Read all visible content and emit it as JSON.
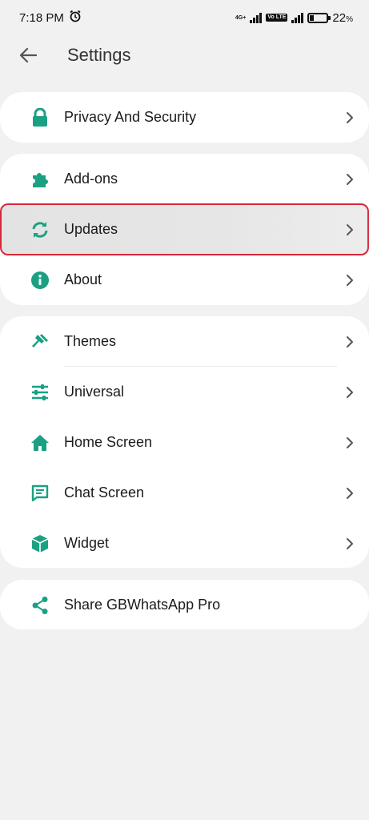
{
  "status": {
    "time": "7:18 PM",
    "net1": "4G+",
    "volte": "Vo LTE",
    "battery": "22",
    "battery_unit": "%",
    "battery_level": 0.22
  },
  "header": {
    "title": "Settings"
  },
  "groups": [
    {
      "items": [
        {
          "label": "Privacy And Security",
          "icon": "lock-icon"
        }
      ]
    },
    {
      "items": [
        {
          "label": "Add-ons",
          "icon": "puzzle-icon"
        },
        {
          "label": "Updates",
          "icon": "sync-icon",
          "highlighted": true
        },
        {
          "label": "About",
          "icon": "info-icon"
        }
      ]
    },
    {
      "items": [
        {
          "label": "Themes",
          "icon": "paint-icon"
        },
        {
          "label": "Universal",
          "icon": "sliders-icon"
        },
        {
          "label": "Home Screen",
          "icon": "home-icon"
        },
        {
          "label": "Chat Screen",
          "icon": "chat-icon"
        },
        {
          "label": "Widget",
          "icon": "cube-icon"
        }
      ]
    },
    {
      "items": [
        {
          "label": "Share GBWhatsApp Pro",
          "icon": "share-icon"
        }
      ]
    }
  ],
  "colors": {
    "accent": "#1aa083",
    "highlight_border": "#d6283a"
  }
}
